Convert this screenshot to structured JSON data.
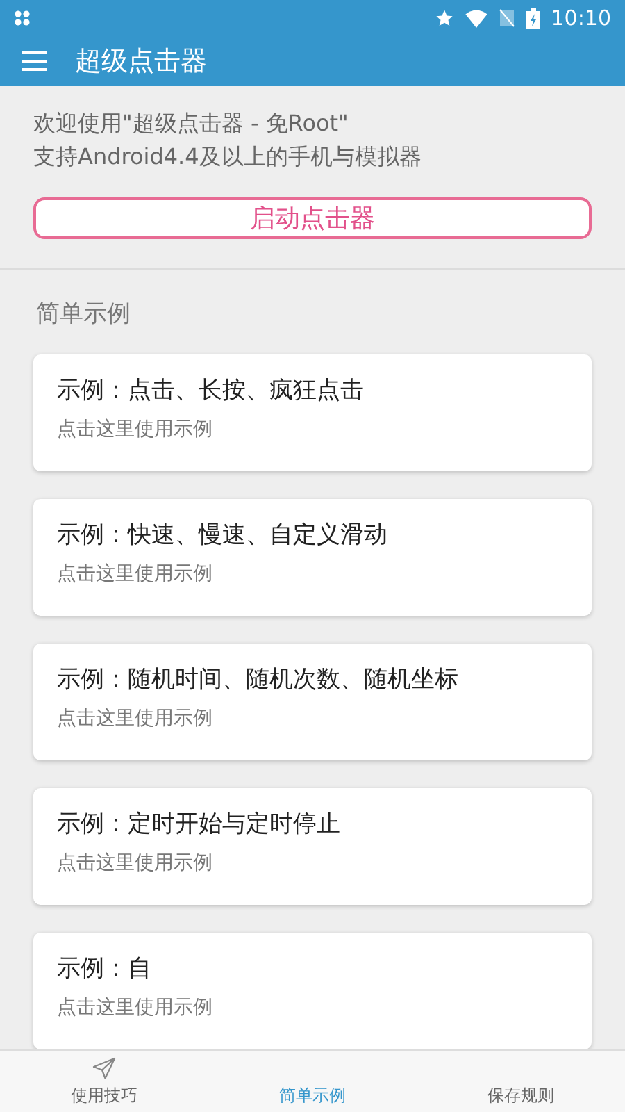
{
  "status_bar": {
    "time": "10:10"
  },
  "app_bar": {
    "title": "超级点击器"
  },
  "intro": [
    "欢迎使用\"超级点击器 - 免Root\"",
    "支持Android4.4及以上的手机与模拟器"
  ],
  "start_button": {
    "label": "启动点击器"
  },
  "section": {
    "title": "简单示例"
  },
  "examples": [
    {
      "title": "示例：点击、长按、疯狂点击",
      "subtitle": "点击这里使用示例"
    },
    {
      "title": "示例：快速、慢速、自定义滑动",
      "subtitle": "点击这里使用示例"
    },
    {
      "title": "示例：随机时间、随机次数、随机坐标",
      "subtitle": "点击这里使用示例"
    },
    {
      "title": "示例：定时开始与定时停止",
      "subtitle": "点击这里使用示例"
    },
    {
      "title": "示例：自",
      "subtitle": "点击这里使用示例"
    }
  ],
  "bottom_nav": [
    {
      "label": "使用技巧",
      "selected": false,
      "icon": true
    },
    {
      "label": "简单示例",
      "selected": true,
      "icon": false
    },
    {
      "label": "保存规则",
      "selected": false,
      "icon": false
    }
  ]
}
